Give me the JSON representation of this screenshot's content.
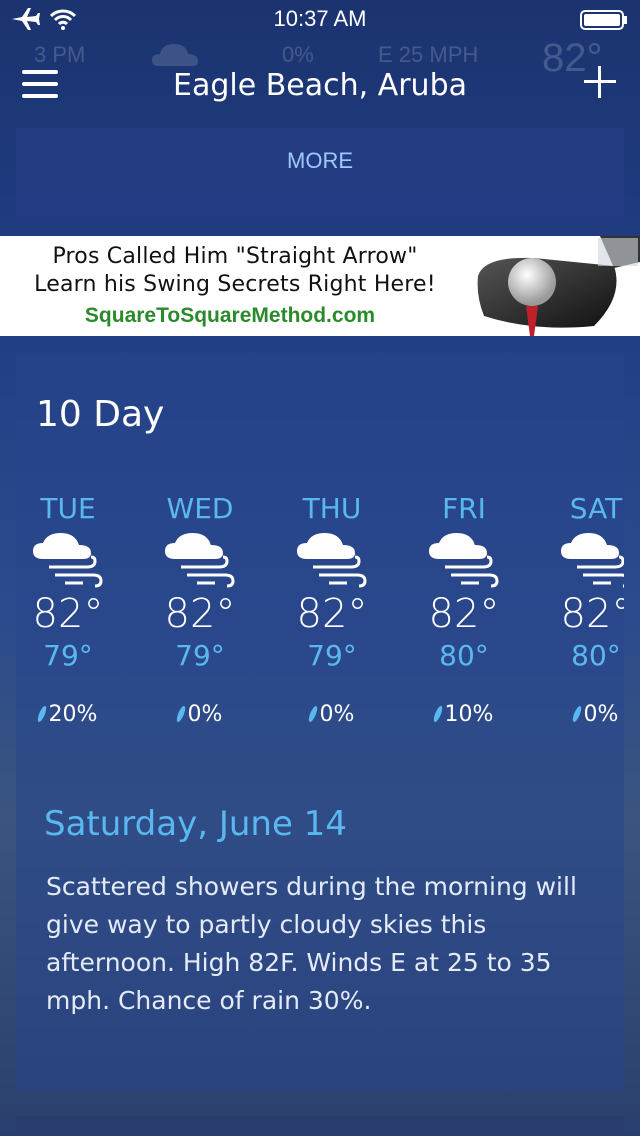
{
  "status_bar": {
    "time": "10:37 AM"
  },
  "ghost_row": {
    "hour": "3 PM",
    "precip": "0%",
    "wind": "E 25 MPH",
    "temp": "82°"
  },
  "header": {
    "location": "Eagle Beach, Aruba"
  },
  "more_panel": {
    "label": "MORE"
  },
  "ad": {
    "line1": "Pros Called Him \"Straight Arrow\"",
    "line2": "Learn his Swing Secrets Right Here!",
    "url": "SquareToSquareMethod.com"
  },
  "tenday": {
    "title": "10 Day",
    "days": [
      {
        "name": "TUE",
        "high": "82°",
        "low": "79°",
        "precip": "20%",
        "icon": "cloud-wind-icon"
      },
      {
        "name": "WED",
        "high": "82°",
        "low": "79°",
        "precip": "0%",
        "icon": "cloud-wind-icon"
      },
      {
        "name": "THU",
        "high": "82°",
        "low": "79°",
        "precip": "0%",
        "icon": "cloud-wind-icon"
      },
      {
        "name": "FRI",
        "high": "82°",
        "low": "80°",
        "precip": "10%",
        "icon": "cloud-wind-icon"
      },
      {
        "name": "SAT",
        "high": "82°",
        "low": "80°",
        "precip": "0%",
        "icon": "cloud-wind-icon"
      }
    ],
    "selected_date": "Saturday, June 14",
    "description": "Scattered showers during the morning will give way to partly cloudy skies this afternoon. High 82F. Winds E at 25 to 35 mph. Chance of rain 30%."
  },
  "colors": {
    "accent": "#5ab8f0",
    "link": "#9ec9ff",
    "ad_url": "#2b8a2b"
  }
}
